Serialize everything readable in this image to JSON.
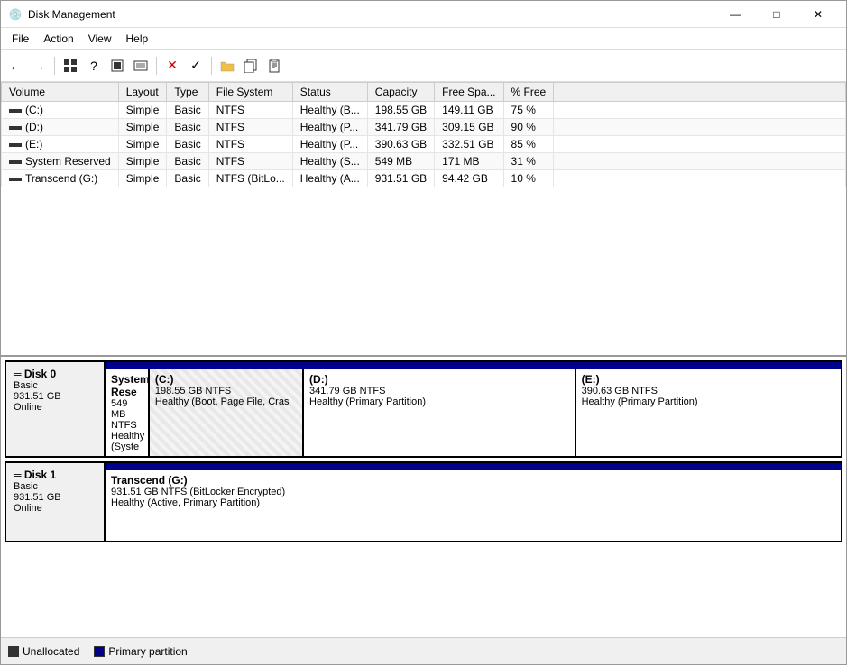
{
  "window": {
    "title": "Disk Management",
    "icon": "💿"
  },
  "menu": {
    "items": [
      "File",
      "Action",
      "View",
      "Help"
    ]
  },
  "toolbar": {
    "buttons": [
      "←",
      "→",
      "▦",
      "?",
      "▦",
      "⬛",
      "✕",
      "✓",
      "📁",
      "📋",
      "📄"
    ]
  },
  "table": {
    "columns": [
      "Volume",
      "Layout",
      "Type",
      "File System",
      "Status",
      "Capacity",
      "Free Spa...",
      "% Free"
    ],
    "rows": [
      {
        "volume": "(C:)",
        "layout": "Simple",
        "type": "Basic",
        "fs": "NTFS",
        "status": "Healthy (B...",
        "capacity": "198.55 GB",
        "free": "149.11 GB",
        "pctfree": "75 %"
      },
      {
        "volume": "(D:)",
        "layout": "Simple",
        "type": "Basic",
        "fs": "NTFS",
        "status": "Healthy (P...",
        "capacity": "341.79 GB",
        "free": "309.15 GB",
        "pctfree": "90 %"
      },
      {
        "volume": "(E:)",
        "layout": "Simple",
        "type": "Basic",
        "fs": "NTFS",
        "status": "Healthy (P...",
        "capacity": "390.63 GB",
        "free": "332.51 GB",
        "pctfree": "85 %"
      },
      {
        "volume": "System Reserved",
        "layout": "Simple",
        "type": "Basic",
        "fs": "NTFS",
        "status": "Healthy (S...",
        "capacity": "549 MB",
        "free": "171 MB",
        "pctfree": "31 %"
      },
      {
        "volume": "Transcend (G:)",
        "layout": "Simple",
        "type": "Basic",
        "fs": "NTFS (BitLo...",
        "status": "Healthy (A...",
        "capacity": "931.51 GB",
        "free": "94.42 GB",
        "pctfree": "10 %"
      }
    ]
  },
  "disk0": {
    "label": "Disk 0",
    "type": "Basic",
    "size": "931.51 GB",
    "status": "Online",
    "partitions": [
      {
        "name": "System Rese",
        "size": "549 MB NTFS",
        "status": "Healthy (Syste",
        "width": "4",
        "hatched": false
      },
      {
        "name": "(C:)",
        "size": "198.55 GB NTFS",
        "status": "Healthy (Boot, Page File, Cras",
        "width": "21",
        "hatched": true
      },
      {
        "name": "(D:)",
        "size": "341.79 GB NTFS",
        "status": "Healthy (Primary Partition)",
        "width": "37",
        "hatched": false
      },
      {
        "name": "(E:)",
        "size": "390.63 GB NTFS",
        "status": "Healthy (Primary Partition)",
        "width": "42",
        "hatched": false
      }
    ]
  },
  "disk1": {
    "label": "Disk 1",
    "type": "Basic",
    "size": "931.51 GB",
    "status": "Online",
    "partitions": [
      {
        "name": "Transcend  (G:)",
        "size": "931.51 GB NTFS (BitLocker Encrypted)",
        "status": "Healthy (Active, Primary Partition)",
        "width": "100",
        "hatched": false
      }
    ]
  },
  "legend": {
    "items": [
      {
        "label": "Unallocated",
        "color": "unalloc"
      },
      {
        "label": "Primary partition",
        "color": "primary"
      }
    ]
  }
}
